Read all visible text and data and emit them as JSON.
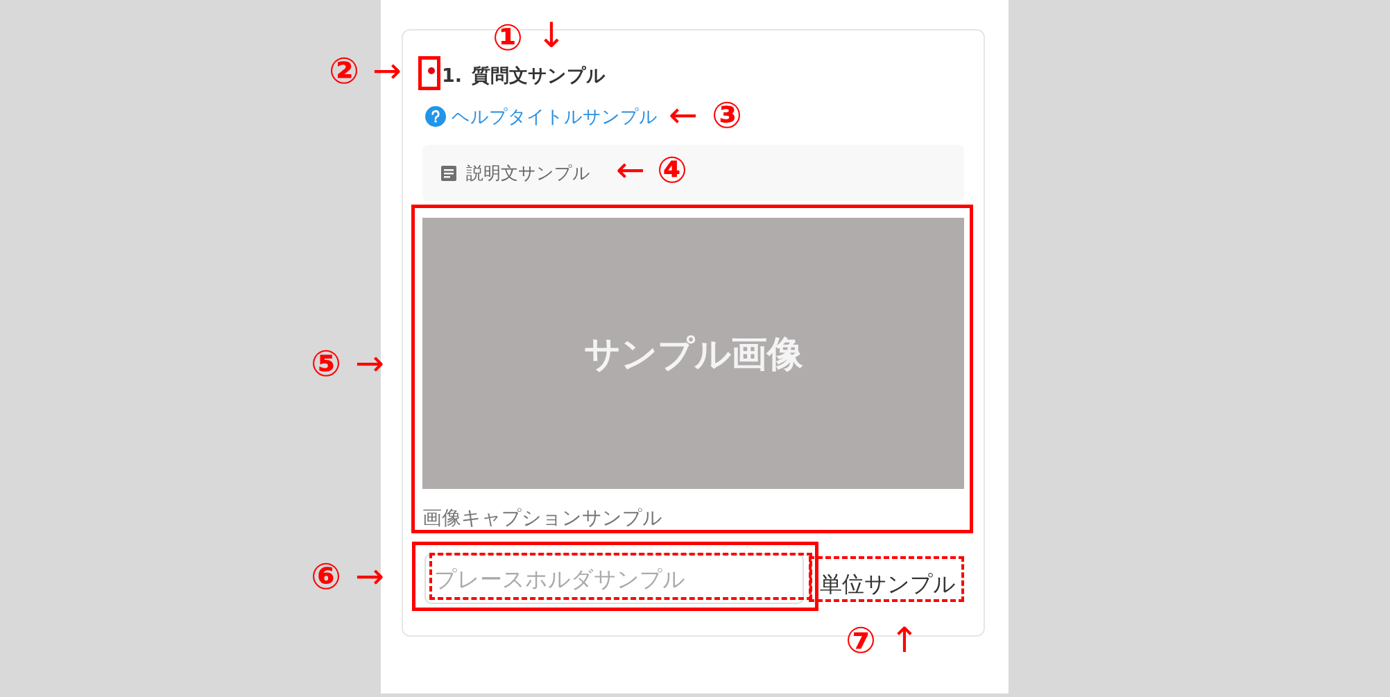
{
  "question": {
    "required": true,
    "number": "1.",
    "title": "質問文サンプル"
  },
  "help": {
    "title": "ヘルプタイトルサンプル"
  },
  "description": {
    "text": "説明文サンプル"
  },
  "image": {
    "text": "サンプル画像",
    "caption": "画像キャプションサンプル"
  },
  "answer": {
    "placeholder": "プレースホルダサンプル",
    "unit": "単位サンプル"
  },
  "callouts": [
    {
      "number": "①",
      "arrow": "↓"
    },
    {
      "number": "②",
      "arrow": "→"
    },
    {
      "number": "③",
      "arrow": "←"
    },
    {
      "number": "④",
      "arrow": "←"
    },
    {
      "number": "⑤",
      "arrow": "→"
    },
    {
      "number": "⑥",
      "arrow": "→"
    },
    {
      "number": "⑦",
      "arrow": "↑"
    }
  ]
}
